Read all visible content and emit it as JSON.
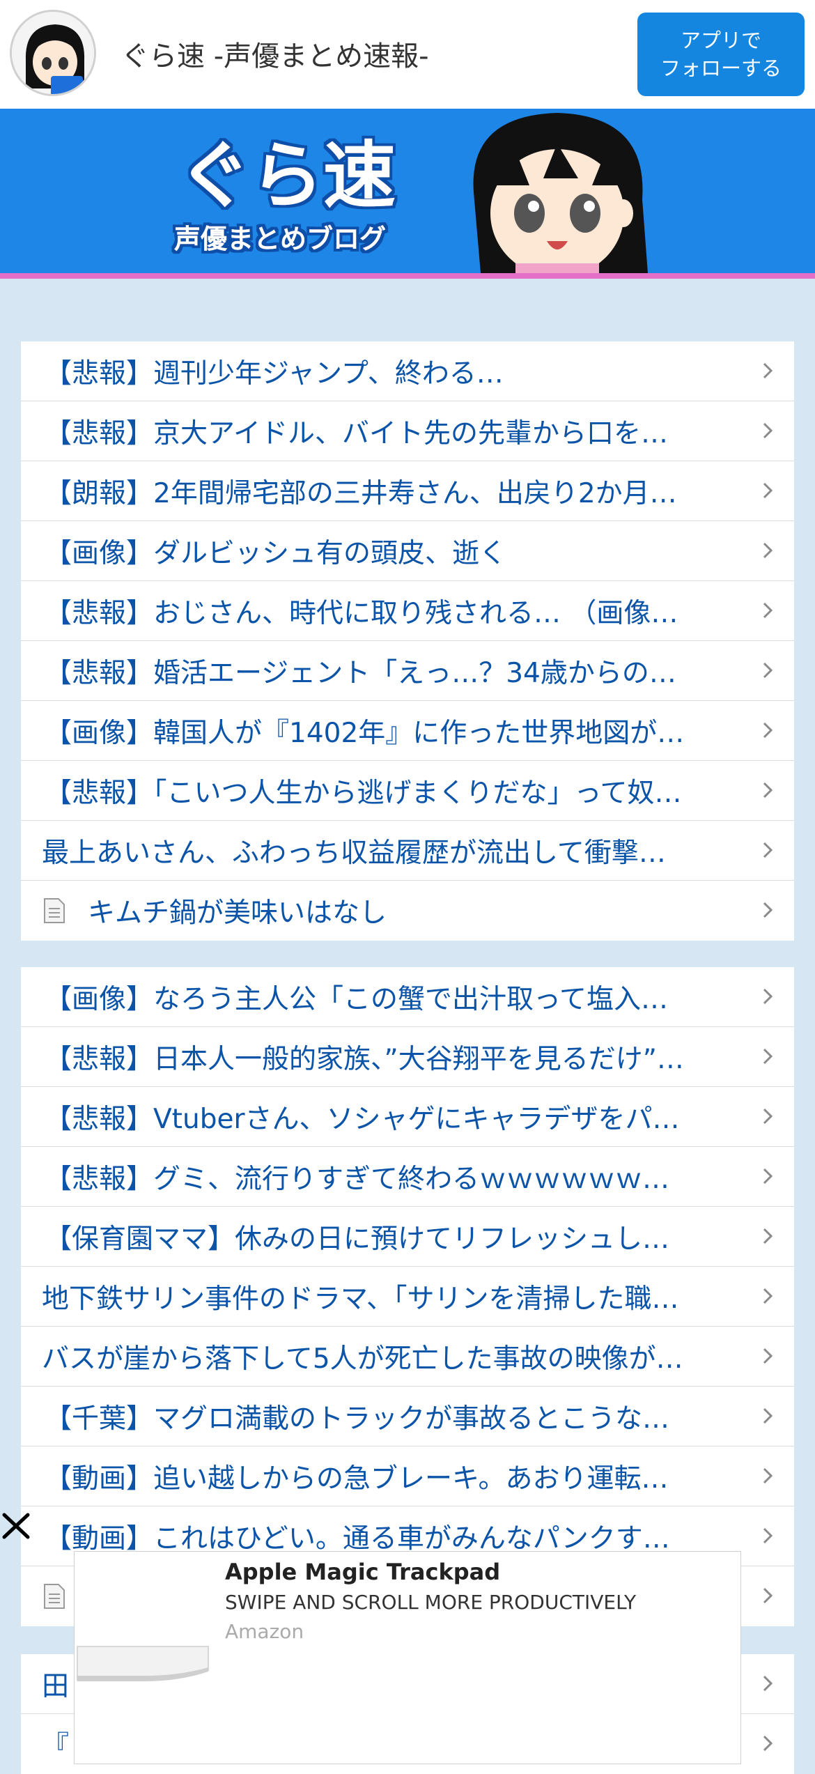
{
  "header": {
    "site_title": "ぐら速 -声優まとめ速報-",
    "follow_line1": "アプリで",
    "follow_line2": "フォローする"
  },
  "banner": {
    "logo_text": "ぐら速",
    "logo_sub": "声優まとめブログ",
    "bg_color": "#1e86e6",
    "accent_line_color": "#e46fc8"
  },
  "list1": [
    {
      "text": "【悲報】週刊少年ジャンプ、終わる…",
      "type": "bracket"
    },
    {
      "text": "【悲報】京大アイドル、バイト先の先輩から口を…",
      "type": "bracket"
    },
    {
      "text": "【朗報】2年間帰宅部の三井寿さん、出戻り2か月…",
      "type": "bracket"
    },
    {
      "text": "【画像】ダルビッシュ有の頭皮、逝く",
      "type": "bracket"
    },
    {
      "text": "【悲報】おじさん、時代に取り残される… （画像…",
      "type": "bracket"
    },
    {
      "text": "【悲報】婚活エージェント「えっ…？34歳からの…",
      "type": "bracket"
    },
    {
      "text": "【画像】韓国人が『1402年』に作った世界地図が…",
      "type": "bracket"
    },
    {
      "text": "【悲報】「こいつ人生から逃げまくりだな」って奴…",
      "type": "bracket"
    },
    {
      "text": "最上あいさん、ふわっち収益履歴が流出して衝撃…",
      "type": "plain"
    },
    {
      "text": "キムチ鍋が美味いはなし",
      "type": "doc"
    }
  ],
  "list2": [
    {
      "text": "【画像】なろう主人公「この蟹で出汁取って塩入…",
      "type": "bracket"
    },
    {
      "text": "【悲報】日本人一般的家族、”大谷翔平を見るだけ”…",
      "type": "bracket"
    },
    {
      "text": "【悲報】Vtuberさん、ソシャゲにキャラデザをパ…",
      "type": "bracket"
    },
    {
      "text": "【悲報】グミ、流行りすぎて終わるｗｗｗｗｗｗ…",
      "type": "bracket"
    },
    {
      "text": "【保育園ママ】休みの日に預けてリフレッシュし…",
      "type": "bracket"
    },
    {
      "text": "地下鉄サリン事件のドラマ、「サリンを清掃した職…",
      "type": "plain"
    },
    {
      "text": "バスが崖から落下して5人が死亡した事故の映像が…",
      "type": "plain"
    },
    {
      "text": "【千葉】マグロ満載のトラックが事故るとこうな…",
      "type": "bracket"
    },
    {
      "text": "【動画】追い越しからの急ブレーキ。あおり運転…",
      "type": "bracket"
    },
    {
      "text": "【動画】これはひどい。通る車がみんなパンクす…",
      "type": "bracket"
    },
    {
      "text": "",
      "type": "doc"
    }
  ],
  "list3": [
    {
      "text": "田",
      "type": "plain"
    },
    {
      "text": "『",
      "type": "plain"
    }
  ],
  "ad": {
    "title": "Apple Magic Trackpad",
    "subtitle": "SWIPE AND SCROLL MORE PRODUCTIVELY",
    "source": "Amazon"
  }
}
